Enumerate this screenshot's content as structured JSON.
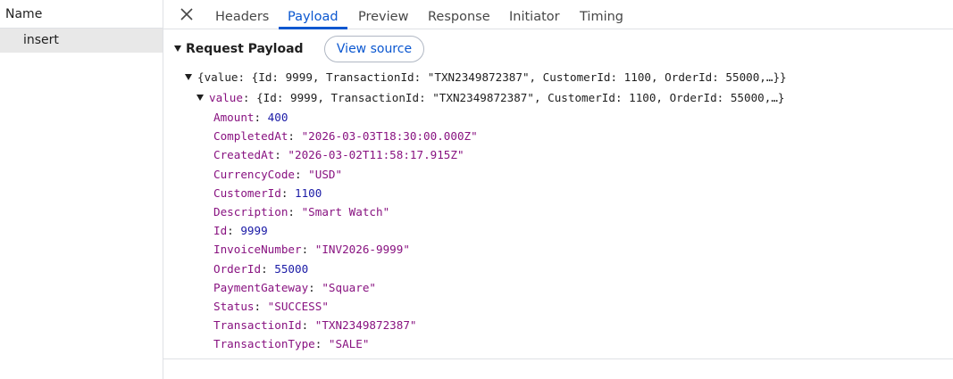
{
  "left_panel": {
    "header": "Name",
    "requests": [
      "insert"
    ]
  },
  "tabs": [
    {
      "label": "Headers"
    },
    {
      "label": "Payload"
    },
    {
      "label": "Preview"
    },
    {
      "label": "Response"
    },
    {
      "label": "Initiator"
    },
    {
      "label": "Timing"
    }
  ],
  "active_tab": "Payload",
  "payload": {
    "section_title": "Request Payload",
    "view_source_label": "View source",
    "root_summary": "{value: {Id: 9999, TransactionId: \"TXN2349872387\", CustomerId: 1100, OrderId: 55000,…}}",
    "value_key": "value",
    "value_summary": "{Id: 9999, TransactionId: \"TXN2349872387\", CustomerId: 1100, OrderId: 55000,…}",
    "fields": [
      {
        "key": "Amount",
        "value": "400",
        "kind": "num"
      },
      {
        "key": "CompletedAt",
        "value": "\"2026-03-03T18:30:00.000Z\"",
        "kind": "str"
      },
      {
        "key": "CreatedAt",
        "value": "\"2026-03-02T11:58:17.915Z\"",
        "kind": "str"
      },
      {
        "key": "CurrencyCode",
        "value": "\"USD\"",
        "kind": "str"
      },
      {
        "key": "CustomerId",
        "value": "1100",
        "kind": "num"
      },
      {
        "key": "Description",
        "value": "\"Smart Watch\"",
        "kind": "str"
      },
      {
        "key": "Id",
        "value": "9999",
        "kind": "num"
      },
      {
        "key": "InvoiceNumber",
        "value": "\"INV2026-9999\"",
        "kind": "str"
      },
      {
        "key": "OrderId",
        "value": "55000",
        "kind": "num"
      },
      {
        "key": "PaymentGateway",
        "value": "\"Square\"",
        "kind": "str"
      },
      {
        "key": "Status",
        "value": "\"SUCCESS\"",
        "kind": "str"
      },
      {
        "key": "TransactionId",
        "value": "\"TXN2349872387\"",
        "kind": "str"
      },
      {
        "key": "TransactionType",
        "value": "\"SALE\"",
        "kind": "str"
      }
    ]
  },
  "colors": {
    "accent": "#0b57d0",
    "key": "#881280",
    "number": "#1a1aa6",
    "string": "#881280"
  }
}
